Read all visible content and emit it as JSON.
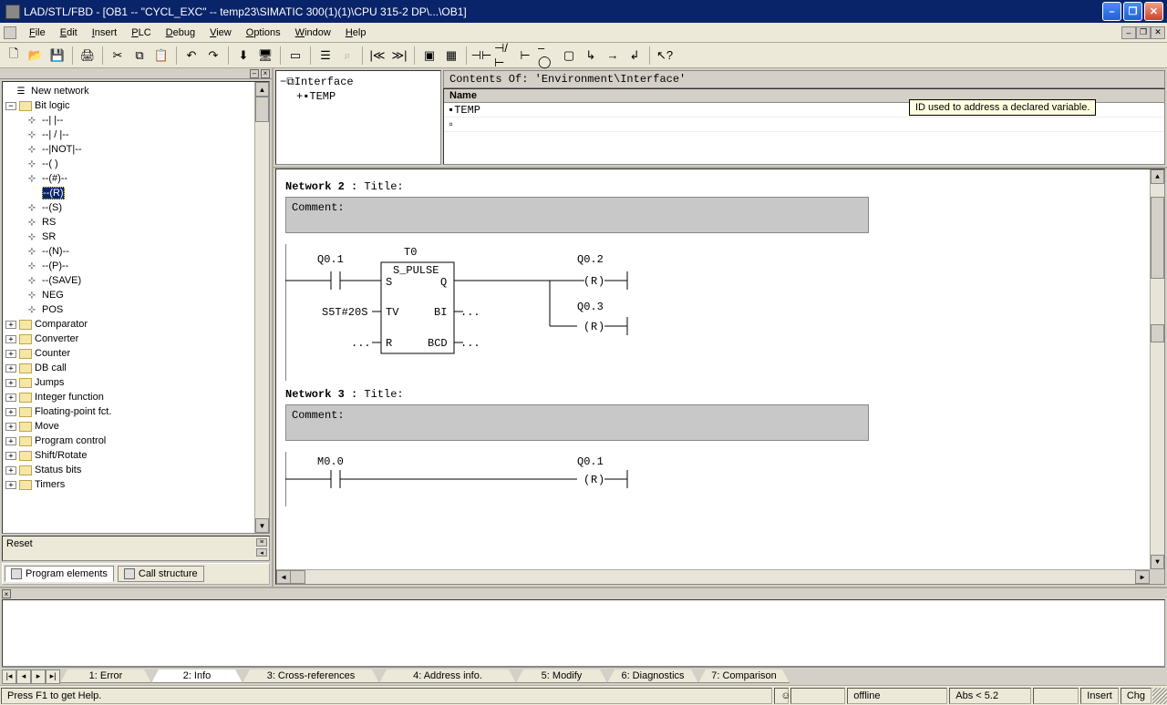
{
  "title": "LAD/STL/FBD  - [OB1 -- \"CYCL_EXC\" -- temp23\\SIMATIC 300(1)(1)\\CPU 315-2 DP\\...\\OB1]",
  "menu": [
    "File",
    "Edit",
    "Insert",
    "PLC",
    "Debug",
    "View",
    "Options",
    "Window",
    "Help"
  ],
  "tree": {
    "new_network": "New network",
    "bit_logic": "Bit logic",
    "bits": [
      "--| |--",
      "--| / |--",
      "--|NOT|--",
      "--( )",
      "--(#)--",
      "--(R)",
      "--(S)",
      "RS",
      "SR",
      "--(N)--",
      "--(P)--",
      "--(SAVE)",
      "NEG",
      "POS"
    ],
    "selected_index": 5,
    "groups": [
      "Comparator",
      "Converter",
      "Counter",
      "DB call",
      "Jumps",
      "Integer function",
      "Floating-point fct.",
      "Move",
      "Program control",
      "Shift/Rotate",
      "Status bits",
      "Timers"
    ]
  },
  "reset_label": "Reset",
  "left_tabs": {
    "program_elements": "Program elements",
    "call_structure": "Call structure"
  },
  "interface": {
    "root": "Interface",
    "temp": "TEMP",
    "header": "Contents Of: 'Environment\\Interface'",
    "col_name": "Name",
    "row_temp": "TEMP",
    "tooltip": "ID used to address a declared variable."
  },
  "networks": [
    {
      "title_label": "Network 2 :",
      "title_suffix": " Title:",
      "comment_label": "Comment:",
      "ladder": {
        "timer": "T0",
        "block": "S_PULSE",
        "in1_top": "Q0.1",
        "in2_lbl": "S5T#20S",
        "ports_left": [
          "S",
          "TV",
          "R"
        ],
        "ports_right": [
          "Q",
          "BI",
          "BCD"
        ],
        "in3_lbl": "...",
        "bi_out": "...",
        "bcd_out": "...",
        "out1": "Q0.2",
        "out2": "Q0.3",
        "coil": "R"
      }
    },
    {
      "title_label": "Network 3 :",
      "title_suffix": " Title:",
      "comment_label": "Comment:",
      "ladder": {
        "in1_top": "M0.0",
        "out1": "Q0.1",
        "coil": "R"
      }
    }
  ],
  "output_tabs": [
    "1: Error",
    "2: Info",
    "3: Cross-references",
    "4: Address info.",
    "5: Modify",
    "6: Diagnostics",
    "7: Comparison"
  ],
  "status": {
    "help": "Press F1 to get Help.",
    "offline": "offline",
    "abs": "Abs < 5.2",
    "insert": "Insert",
    "chg": "Chg"
  }
}
